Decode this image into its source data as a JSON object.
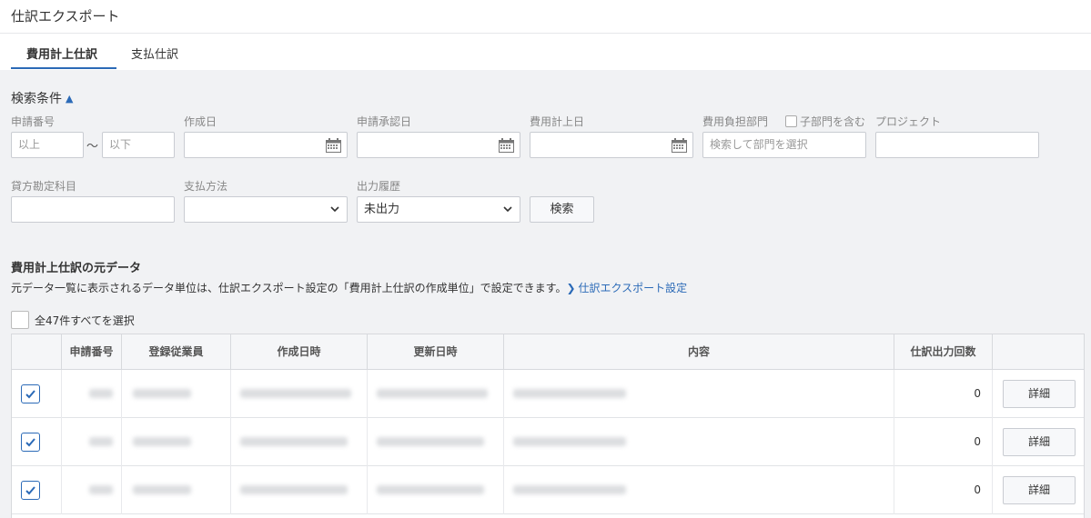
{
  "page": {
    "title": "仕訳エクスポート"
  },
  "tabs": [
    {
      "label": "費用計上仕訳",
      "active": true
    },
    {
      "label": "支払仕訳",
      "active": false
    }
  ],
  "search": {
    "title": "検索条件",
    "application_number": {
      "label": "申請番号",
      "from_placeholder": "以上",
      "to_placeholder": "以下",
      "separator": "～"
    },
    "created_date": {
      "label": "作成日",
      "value": ""
    },
    "approval_date": {
      "label": "申請承認日",
      "value": ""
    },
    "expense_date": {
      "label": "費用計上日",
      "value": ""
    },
    "department": {
      "label": "費用負担部門",
      "include_children_label": "子部門を含む",
      "include_children": false,
      "placeholder": "検索して部門を選択"
    },
    "project": {
      "label": "プロジェクト",
      "value": ""
    },
    "credit_account": {
      "label": "貸方勘定科目",
      "value": ""
    },
    "payment_method": {
      "label": "支払方法",
      "value": ""
    },
    "output_history": {
      "label": "出力履歴",
      "value": "未出力"
    },
    "search_button": "検索"
  },
  "section": {
    "title": "費用計上仕訳の元データ",
    "description": "元データ一覧に表示されるデータ単位は、仕訳エクスポート設定の「費用計上仕訳の作成単位」で設定できます。",
    "link_label": "仕訳エクスポート設定",
    "select_all_label": "全47件すべてを選択"
  },
  "table": {
    "columns": [
      "申請番号",
      "登録従業員",
      "作成日時",
      "更新日時",
      "内容",
      "仕訳出力回数",
      ""
    ],
    "rows": [
      {
        "checked": true,
        "output_count": "0",
        "action": "詳細"
      },
      {
        "checked": true,
        "output_count": "0",
        "action": "詳細"
      },
      {
        "checked": true,
        "output_count": "0",
        "action": "詳細"
      }
    ]
  },
  "colors": {
    "accent": "#2b6ab7",
    "background": "#f1f2f4"
  }
}
